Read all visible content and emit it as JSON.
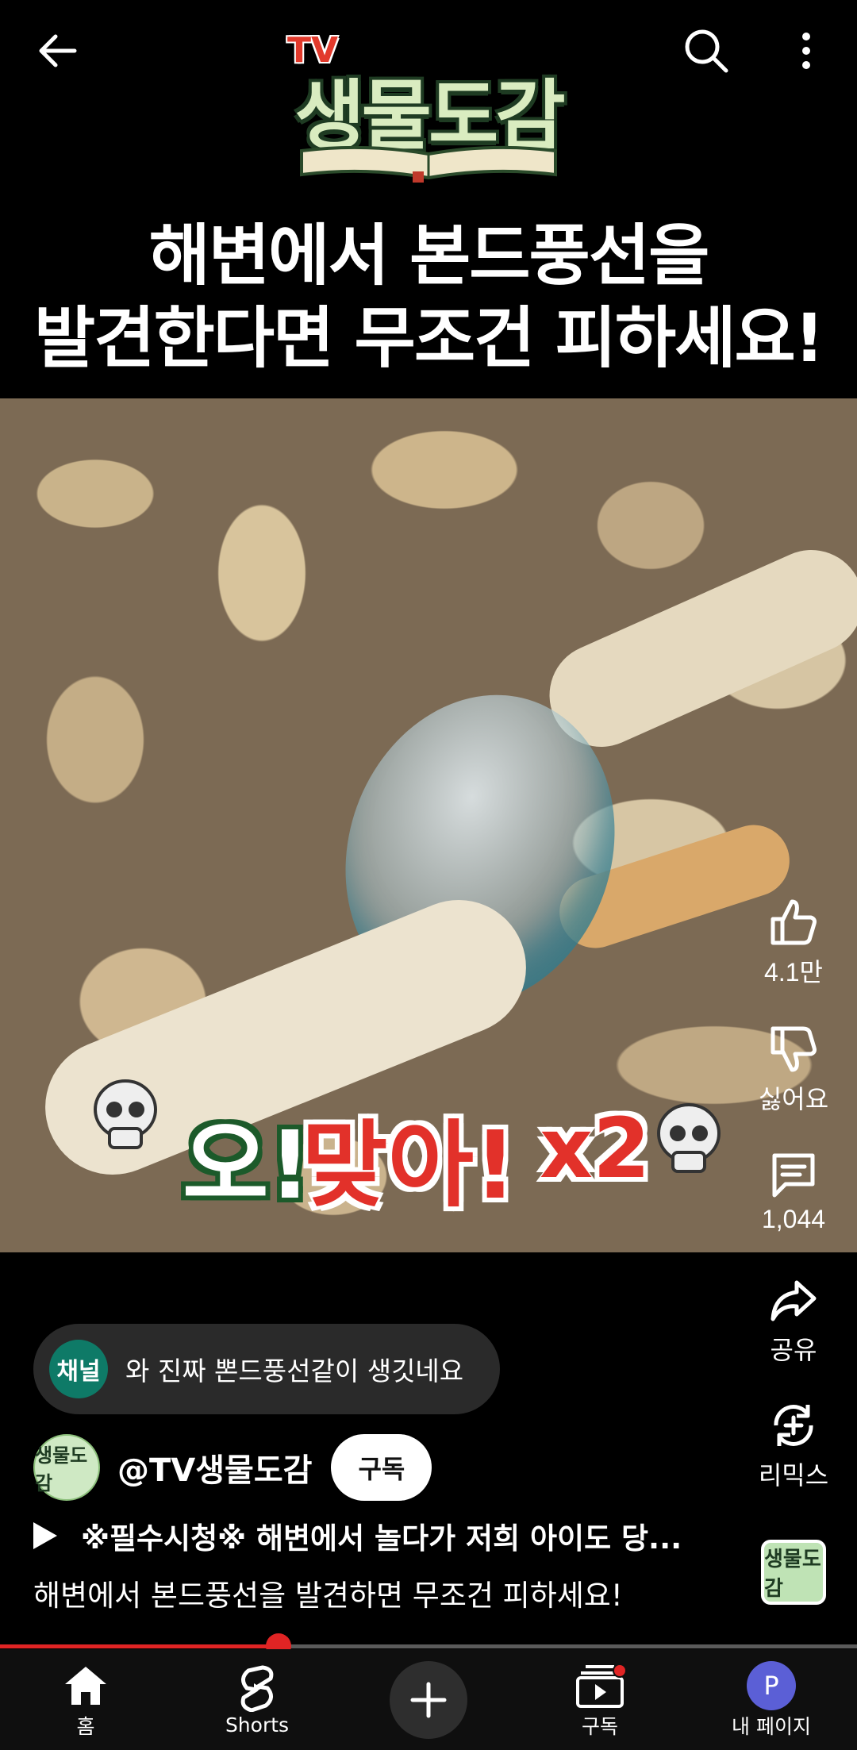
{
  "header": {
    "logo_tv": "TV",
    "logo_name": "생물도감"
  },
  "video": {
    "title_line1": "해변에서 본드풍선을",
    "title_line2": "발견한다면 무조건 피하세요!",
    "overlay_oh": "오!",
    "overlay_right": "맞아!",
    "overlay_x2": "x2",
    "progress": 0.325
  },
  "actions": {
    "like": "4.1만",
    "dislike": "싫어요",
    "comments": "1,044",
    "share": "공유",
    "remix": "리믹스",
    "thumb_text": "생물도감"
  },
  "comment_pill": {
    "chip": "채널",
    "text": "와 진짜 뽄드풍선같이 생깃네요"
  },
  "channel": {
    "avatar_text": "생물도감",
    "handle": "@TV생물도감",
    "subscribe": "구독"
  },
  "playlist": "※필수시청※ 해변에서 놀다가 저희 아이도 당...",
  "description": "해변에서 본드풍선을 발견하면 무조건 피하세요!",
  "nav": {
    "home": "홈",
    "shorts": "Shorts",
    "subscriptions": "구독",
    "me_initial": "P",
    "me": "내 페이지"
  },
  "colors": {
    "accent": "#e02424",
    "channel_chip": "#0e7a67",
    "avatar": "#5b5fd6"
  }
}
